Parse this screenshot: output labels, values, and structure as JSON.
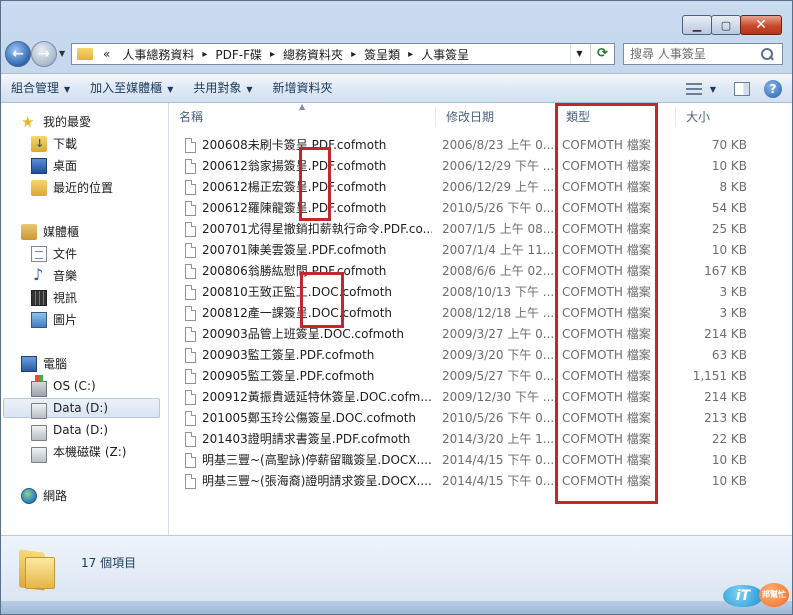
{
  "address": {
    "overflow": "«",
    "crumbs": [
      "人事總務資料",
      "PDF-F碟",
      "總務資料夾",
      "簽呈類",
      "人事簽呈"
    ]
  },
  "search": {
    "placeholder": "搜尋 人事簽呈"
  },
  "toolbar": {
    "organize": "組合管理",
    "include_library": "加入至媒體櫃",
    "share": "共用對象",
    "new_folder": "新增資料夾"
  },
  "nav": {
    "favorites": "我的最愛",
    "downloads": "下載",
    "desktop": "桌面",
    "recent": "最近的位置",
    "libraries": "媒體櫃",
    "documents": "文件",
    "music": "音樂",
    "videos": "視訊",
    "pictures": "圖片",
    "computer": "電腦",
    "drive_c": "OS (C:)",
    "drive_d1": "Data (D:)",
    "drive_d2": "Data (D:)",
    "drive_z": "本機磁碟 (Z:)",
    "network": "網路"
  },
  "columns": {
    "name": "名稱",
    "date": "修改日期",
    "type": "類型",
    "size": "大小"
  },
  "files": [
    {
      "name": "200608未刷卡簽呈.PDF.cofmoth",
      "date": "2006/8/23 上午 0...",
      "type": "COFMOTH 檔案",
      "size": "70 KB"
    },
    {
      "name": "200612翁家揚簽呈.PDF.cofmoth",
      "date": "2006/12/29 下午 ...",
      "type": "COFMOTH 檔案",
      "size": "10 KB"
    },
    {
      "name": "200612楊正宏簽呈.PDF.cofmoth",
      "date": "2006/12/29 上午 ...",
      "type": "COFMOTH 檔案",
      "size": "8 KB"
    },
    {
      "name": "200612羅陳龍簽呈.PDF.cofmoth",
      "date": "2010/5/26 下午 0...",
      "type": "COFMOTH 檔案",
      "size": "54 KB"
    },
    {
      "name": "200701尤得星撤銷扣薪執行命令.PDF.co...",
      "date": "2007/1/5 上午 08...",
      "type": "COFMOTH 檔案",
      "size": "25 KB"
    },
    {
      "name": "200701陳美雲簽呈.PDF.cofmoth",
      "date": "2007/1/4 上午 11...",
      "type": "COFMOTH 檔案",
      "size": "10 KB"
    },
    {
      "name": "200806翁勝紘慰問.PDF.cofmoth",
      "date": "2008/6/6 上午 02...",
      "type": "COFMOTH 檔案",
      "size": "167 KB"
    },
    {
      "name": "200810王致正監工.DOC.cofmoth",
      "date": "2008/10/13 下午 ...",
      "type": "COFMOTH 檔案",
      "size": "3 KB"
    },
    {
      "name": "200812產一課簽呈.DOC.cofmoth",
      "date": "2008/12/18 上午 ...",
      "type": "COFMOTH 檔案",
      "size": "3 KB"
    },
    {
      "name": "200903品管上班簽呈.DOC.cofmoth",
      "date": "2009/3/27 上午 0...",
      "type": "COFMOTH 檔案",
      "size": "214 KB"
    },
    {
      "name": "200903監工簽呈.PDF.cofmoth",
      "date": "2009/3/20 下午 0...",
      "type": "COFMOTH 檔案",
      "size": "63 KB"
    },
    {
      "name": "200905監工簽呈.PDF.cofmoth",
      "date": "2009/5/27 下午 0...",
      "type": "COFMOTH 檔案",
      "size": "1,151 KB"
    },
    {
      "name": "200912黃振貴遞延特休簽呈.DOC.cofm...",
      "date": "2009/12/30 下午 ...",
      "type": "COFMOTH 檔案",
      "size": "214 KB"
    },
    {
      "name": "201005鄭玉玲公傷簽呈.DOC.cofmoth",
      "date": "2010/5/26 下午 0...",
      "type": "COFMOTH 檔案",
      "size": "213 KB"
    },
    {
      "name": "201403證明請求書簽呈.PDF.cofmoth",
      "date": "2014/3/20 上午 1...",
      "type": "COFMOTH 檔案",
      "size": "22 KB"
    },
    {
      "name": "明基三豐~(高聖詠)停薪留職簽呈.DOCX....",
      "date": "2014/4/15 下午 0...",
      "type": "COFMOTH 檔案",
      "size": "10 KB"
    },
    {
      "name": "明基三豐~(張海裔)證明請求簽呈.DOCX....",
      "date": "2014/4/15 下午 0...",
      "type": "COFMOTH 檔案",
      "size": "10 KB"
    }
  ],
  "status": {
    "count": "17 個項目"
  },
  "logo": {
    "text": "iT",
    "tag": "邦幫忙"
  }
}
